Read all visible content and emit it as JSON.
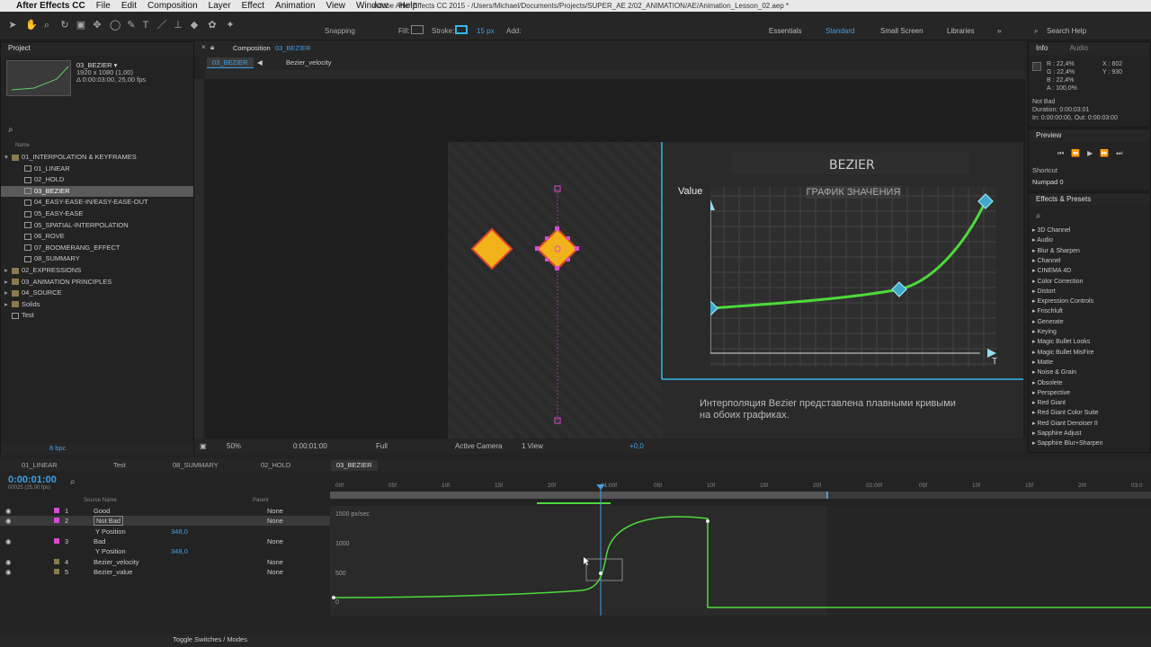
{
  "menubar": {
    "app_name": "After Effects CC",
    "items": [
      "File",
      "Edit",
      "Composition",
      "Layer",
      "Effect",
      "Animation",
      "View",
      "Window",
      "Help"
    ],
    "window_title": "Adobe After Effects CC 2015 - /Users/Michael/Documents/Projects/SUPER_AE 2/02_ANIMATION/AE/Animation_Lesson_02.aep *"
  },
  "toolbar": {
    "snapping_label": "Snapping",
    "fill_label": "Fill:",
    "stroke_label": "Stroke:",
    "stroke_width": "15 px",
    "add_label": "Add:",
    "fill_color": "#f2b21a",
    "stroke_color": "#35b7e6",
    "workspaces": [
      "Essentials",
      "Standard",
      "Small Screen",
      "Libraries"
    ],
    "active_workspace": "Standard",
    "search_help": "Search Help"
  },
  "project": {
    "panel_title": "Project",
    "selected_comp": "03_BEZIER ▾",
    "comp_size": "1920 x 1080 (1,00)",
    "comp_duration": "Δ 0:00:03:00, 25,00 fps",
    "column_name": "Name",
    "items": [
      {
        "label": "01_INTERPOLATION & KEYFRAMES",
        "type": "folder",
        "indent": 0
      },
      {
        "label": "01_LINEAR",
        "type": "comp",
        "indent": 1
      },
      {
        "label": "02_HOLD",
        "type": "comp",
        "indent": 1
      },
      {
        "label": "03_BEZIER",
        "type": "comp",
        "indent": 1,
        "selected": true
      },
      {
        "label": "04_EASY-EASE-IN/EASY-EASE-OUT",
        "type": "comp",
        "indent": 1
      },
      {
        "label": "05_EASY-EASE",
        "type": "comp",
        "indent": 1
      },
      {
        "label": "05_SPATIAL-INTERPOLATION",
        "type": "comp",
        "indent": 1
      },
      {
        "label": "06_ROVE",
        "type": "comp",
        "indent": 1
      },
      {
        "label": "07_BOOMERANG_EFFECT",
        "type": "comp",
        "indent": 1
      },
      {
        "label": "08_SUMMARY",
        "type": "comp",
        "indent": 1
      },
      {
        "label": "02_EXPRESSIONS",
        "type": "folder",
        "indent": 0
      },
      {
        "label": "03_ANIMATION PRINCIPLES",
        "type": "folder",
        "indent": 0
      },
      {
        "label": "04_SOURCE",
        "type": "folder",
        "indent": 0
      },
      {
        "label": "Solids",
        "type": "folder",
        "indent": 0
      },
      {
        "label": "Test",
        "type": "comp",
        "indent": 0
      }
    ],
    "bpc": "8 bpc"
  },
  "composition": {
    "panel_title": "Composition",
    "comp_name": "03_BEZIER",
    "breadcrumb": [
      "03_BEZIER",
      "Bezier_velocity"
    ],
    "bezier_title": "BEZIER",
    "value_label": "Value",
    "graph_title": "ГРАФИК ЗНАЧЕНИЯ",
    "t_label": "T",
    "caption_line1": "Интерполяция Bezier представлена плавными кривыми",
    "caption_line2": "на обоих графиках.",
    "zoom": "50%",
    "timecode": "0:00:01:00",
    "resolution": "Full",
    "camera": "Active Camera",
    "views": "1 View",
    "exposure": "+0,0"
  },
  "info": {
    "tab_info": "Info",
    "tab_audio": "Audio",
    "r": "R : 22,4%",
    "g": "G : 22,4%",
    "b": "B : 22,4%",
    "a": "A : 100,0%",
    "x": "X : 602",
    "y": "Y : 930",
    "layer_name": "Not Bad",
    "duration": "Duration: 0:00:03:01",
    "in_out": "In: 0:00:00:00, Out: 0:00:03:00"
  },
  "preview": {
    "title": "Preview",
    "shortcut_label": "Shortcut",
    "shortcut_value": "Numpad 0"
  },
  "effects": {
    "title": "Effects & Presets",
    "items": [
      "3D Channel",
      "Audio",
      "Blur & Sharpen",
      "Channel",
      "CINEMA 4D",
      "Color Correction",
      "Distort",
      "Expression Controls",
      "Frischluft",
      "Generate",
      "Keying",
      "Magic Bullet Looks",
      "Magic Bullet MisFire",
      "Matte",
      "Noise & Grain",
      "Obsolete",
      "Perspective",
      "Red Giant",
      "Red Giant Color Suite",
      "Red Giant Denoiser II",
      "Sapphire Adjust",
      "Sapphire Blur+Sharpen"
    ]
  },
  "timeline": {
    "tabs": [
      "01_LINEAR",
      "Test",
      "08_SUMMARY",
      "02_HOLD",
      "03_BEZIER"
    ],
    "active_tab": "03_BEZIER",
    "timecode": "0:00:01:00",
    "frame_info": "00025 (25.00 fps)",
    "col_source": "Source Name",
    "col_parent": "Parent",
    "layers": [
      {
        "num": "1",
        "name": "Good",
        "color": "#d94ad4",
        "parent": "None"
      },
      {
        "num": "2",
        "name": "Not Bad",
        "color": "#d94ad4",
        "parent": "None",
        "selected": true
      },
      {
        "prop": "Y Position",
        "value": "348,0"
      },
      {
        "num": "3",
        "name": "Bad",
        "color": "#d94ad4",
        "parent": "None"
      },
      {
        "prop": "Y Position",
        "value": "348,0"
      },
      {
        "num": "4",
        "name": "Bezier_velocity",
        "color": "#8a7a50",
        "parent": "None"
      },
      {
        "num": "5",
        "name": "Bezier_value",
        "color": "#8a7a50",
        "parent": "None"
      }
    ],
    "ruler_ticks": [
      "00f",
      "05f",
      "10f",
      "15f",
      "20f",
      "01:00f",
      "05f",
      "10f",
      "15f",
      "20f",
      "02:00f",
      "05f",
      "10f",
      "15f",
      "20f",
      "03:0"
    ],
    "graph_labels": [
      "1500 px/sec",
      "1000",
      "500",
      "0"
    ],
    "toggle_label": "Toggle Switches / Modes"
  }
}
